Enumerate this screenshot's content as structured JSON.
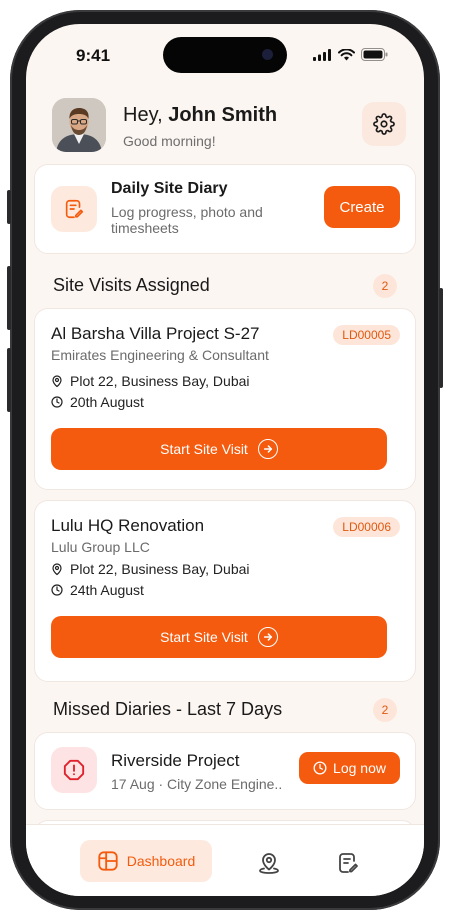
{
  "status_bar": {
    "time": "9:41"
  },
  "header": {
    "greeting_prefix": "Hey, ",
    "user_name": "John Smith",
    "subtitle": "Good morning!"
  },
  "diary": {
    "title": "Daily Site Diary",
    "description": "Log progress, photo and timesheets",
    "create_label": "Create"
  },
  "site_visits": {
    "title": "Site Visits Assigned",
    "count": "2",
    "items": [
      {
        "name": "Al Barsha Villa Project S-27",
        "code": "LD00005",
        "company": "Emirates Engineering & Consultant",
        "location": "Plot 22, Business Bay, Dubai",
        "date": "20th August",
        "action_label": "Start Site Visit"
      },
      {
        "name": "Lulu HQ Renovation",
        "code": "LD00006",
        "company": "Lulu Group LLC",
        "location": "Plot 22, Business Bay, Dubai",
        "date": "24th August",
        "action_label": "Start Site Visit"
      }
    ]
  },
  "missed_diaries": {
    "title": "Missed Diaries - Last 7 Days",
    "count": "2",
    "items": [
      {
        "name": "Riverside Project",
        "meta": "17 Aug  ·  City Zone Engine..",
        "action_label": "Log now"
      }
    ]
  },
  "bottom_nav": {
    "active_label": "Dashboard"
  },
  "colors": {
    "accent": "#f45b0e",
    "accent_soft": "#fde9de",
    "background": "#fcf6f2",
    "danger": "#e0202a"
  },
  "icons": [
    "settings-gear-icon",
    "diary-edit-icon",
    "location-pin-icon",
    "clock-icon",
    "arrow-right-circle-icon",
    "alert-icon",
    "dashboard-grid-icon",
    "map-pin-icon",
    "document-edit-icon"
  ]
}
